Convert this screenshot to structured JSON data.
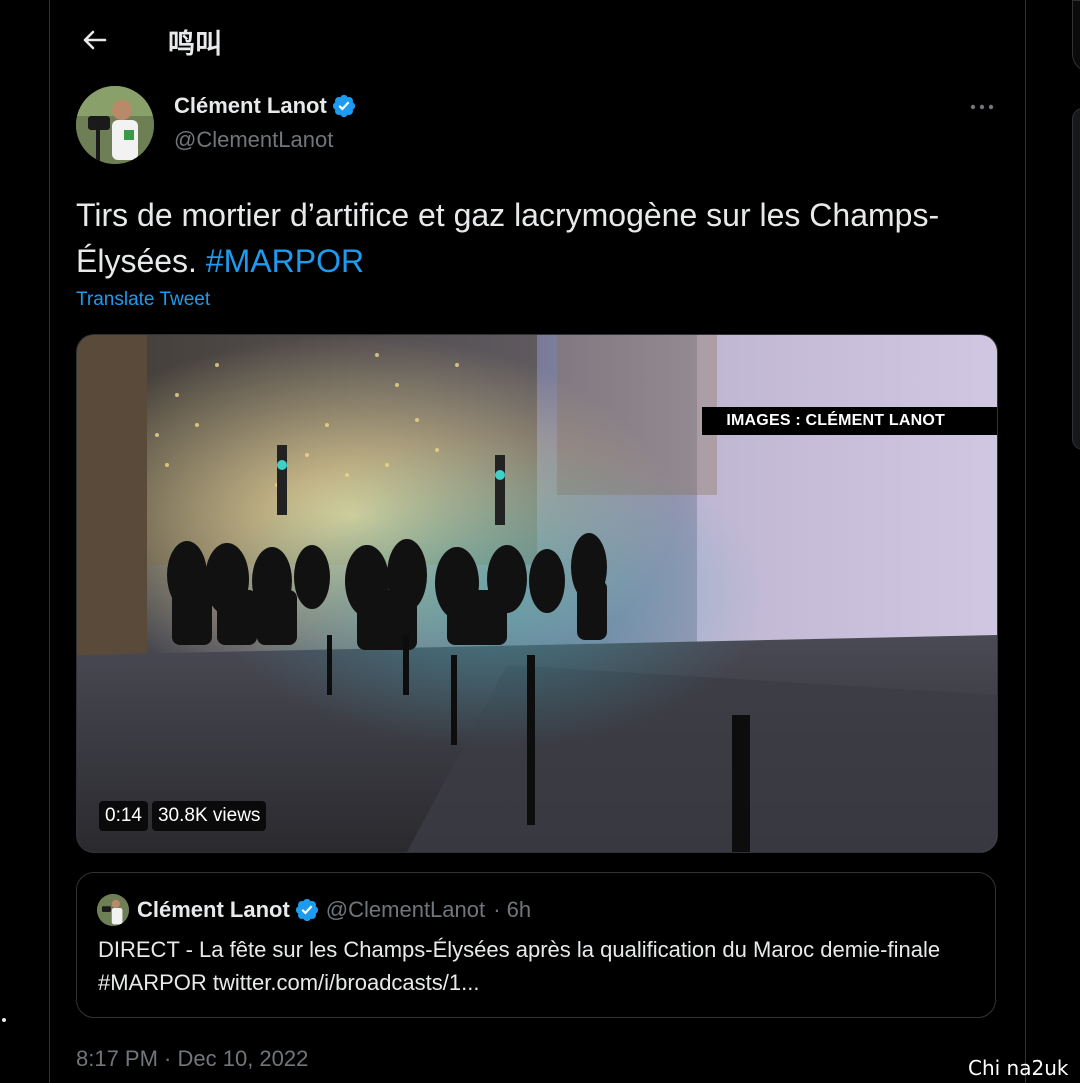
{
  "header": {
    "title": "鸣叫",
    "back_icon": "arrow-left-icon"
  },
  "tweet": {
    "author_name": "Clément Lanot",
    "author_handle": "@ClementLanot",
    "text_main": "Tirs de mortier d’artifice et gaz lacrymogène sur les Champs-Élysées. ",
    "hashtag": "#MARPOR",
    "translate_label": "Translate Tweet",
    "timestamp": "8:17 PM · Dec 10, 2022"
  },
  "media": {
    "credit_overlay": "IMAGES : CLÉMENT LANOT",
    "duration": "0:14",
    "views": "30.8K views"
  },
  "quoted_tweet": {
    "author_name": "Clément Lanot",
    "author_handle": "@ClementLanot",
    "age": "· 6h",
    "text": "DIRECT - La fête sur les Champs-Élysées après la qualification du Maroc demie-finale #MARPOR twitter.com/i/broadcasts/1..."
  },
  "watermark": "Chi na2uk",
  "colors": {
    "background": "#000000",
    "accent": "#1d9bf0",
    "muted": "#71767b",
    "border": "#2f3336"
  }
}
